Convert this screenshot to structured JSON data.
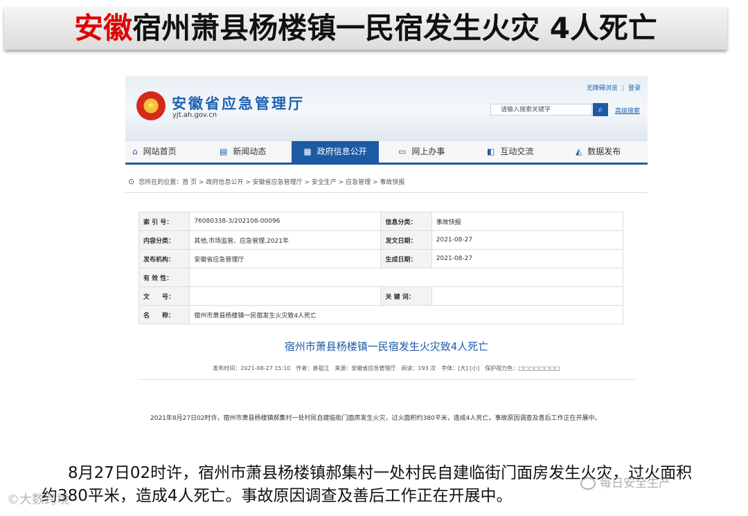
{
  "slide_title": {
    "highlight": "安徽",
    "rest": "宿州萧县杨楼镇一民宿发生火灾 4人死亡"
  },
  "site": {
    "name": "安徽省应急管理厅",
    "domain": "yjt.ah.gov.cn",
    "accessibility_link": "无障碍浏览",
    "login_link": "登录",
    "search_placeholder": "请输入搜索关键字",
    "advanced_search": "高级搜索"
  },
  "nav": [
    {
      "label": "网站首页",
      "icon": "home-icon"
    },
    {
      "label": "新闻动态",
      "icon": "news-icon"
    },
    {
      "label": "政府信息公开",
      "icon": "document-icon",
      "active": true
    },
    {
      "label": "网上办事",
      "icon": "monitor-icon"
    },
    {
      "label": "互动交流",
      "icon": "chat-icon"
    },
    {
      "label": "数据发布",
      "icon": "chart-icon"
    }
  ],
  "breadcrumb": "您所在的位置：首 页 > 政府信息公开 > 安徽省应急管理厅 > 安全生产 > 应急管理 > 事故快报",
  "meta": {
    "index_label": "索 引 号：",
    "index_value": "76080338-3/202108-00096",
    "category_label": "信息分类：",
    "category_value": "事故快报",
    "content_label": "内容分类：",
    "content_value": "其他,市场监管、应急管理,2021年",
    "date_label": "发文日期：",
    "date_value": "2021-08-27",
    "org_label": "发布机构：",
    "org_value": "安徽省应急管理厅",
    "gen_label": "生成日期：",
    "gen_value": "2021-08-27",
    "valid_label": "有 效 性：",
    "valid_value": "",
    "doc_label": "文　　号：",
    "doc_value": "",
    "kw_label": "关 键 词：",
    "kw_value": "",
    "name_label": "名　　称：",
    "name_value": "宿州市萧县杨楼镇一民宿发生火灾致4人死亡"
  },
  "article": {
    "title": "宿州市萧县杨楼镇一民宿发生火灾致4人死亡",
    "byline": "发布时间：2021-08-27 15:10　作者：袁祖江　来源：安徽省应急管理厅　阅读：193 次　字体：[大] [小]　保护视力色：□□□□□□□□",
    "body": "2021年8月27日02时许，宿州市萧县杨楼镇郝集村一处村民自建临街门面房发生火灾，过火面积约380平米，造成4人死亡。事故原因调查及善后工作正在开展中。"
  },
  "caption": "8月27日02时许，宿州市萧县杨楼镇郝集村一处村民自建临街门面房发生火灾，过火面积约380平米，造成4人死亡。事故原因调查及善后工作正在开展中。",
  "watermark_left": "©大数跨境",
  "watermark_right": "每日安全生产"
}
